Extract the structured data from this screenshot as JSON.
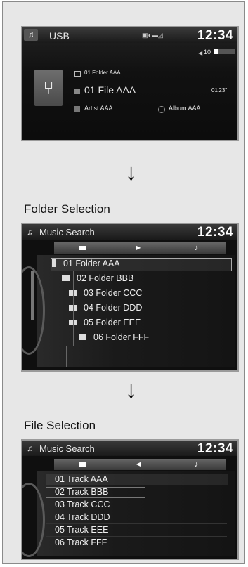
{
  "usb_screen": {
    "source": "USB",
    "clock": "12:34",
    "volume": "10",
    "folder": "01  Folder AAA",
    "file": "01 File AAA",
    "time": "01'23\"",
    "artist": "Artist AAA",
    "album": "Album AAA"
  },
  "arrow_glyph": "↓",
  "folder_selection": {
    "heading": "Folder Selection",
    "title": "Music Search",
    "clock": "12:34",
    "items": [
      "01 Folder AAA",
      "02 Folder BBB",
      "03 Folder CCC",
      "04 Folder DDD",
      "05 Folder EEE",
      "06 Folder FFF"
    ]
  },
  "file_selection": {
    "heading": "File Selection",
    "title": "Music Search",
    "clock": "12:34",
    "items": [
      "01 Track AAA",
      "02 Track BBB",
      "03 Track CCC",
      "04 Track DDD",
      "05 Track EEE",
      "06 Track FFF"
    ]
  }
}
